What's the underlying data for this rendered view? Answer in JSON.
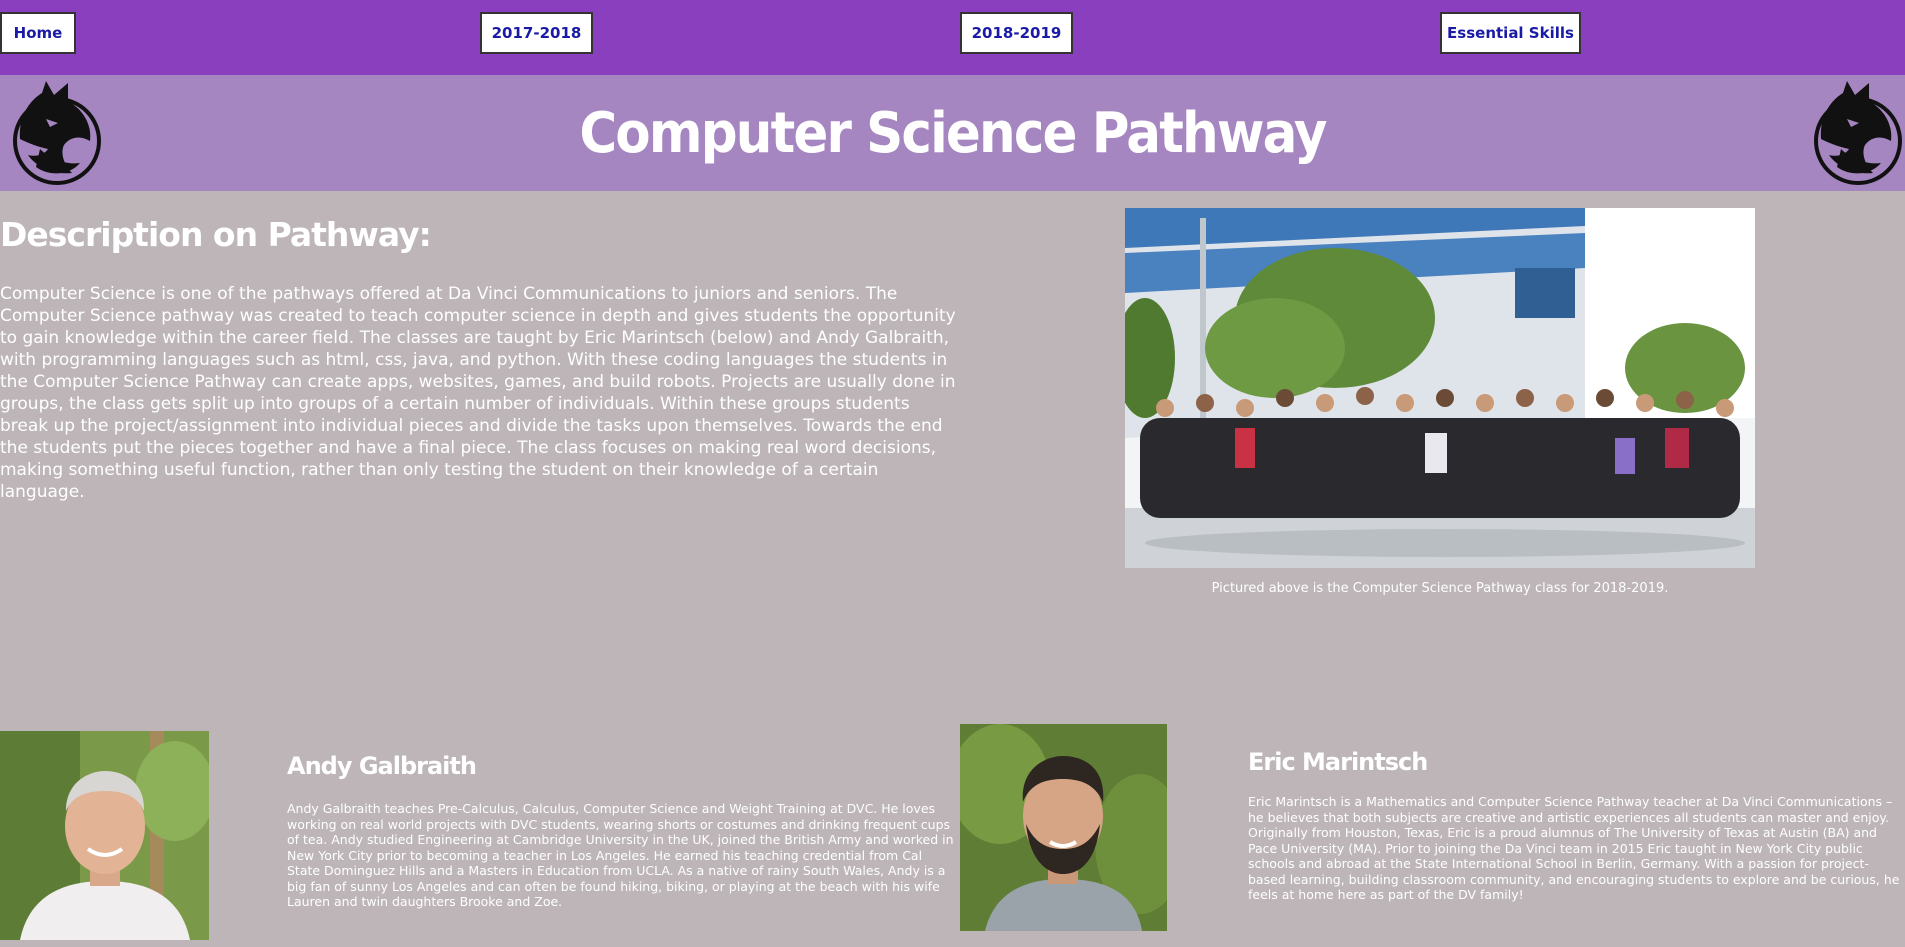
{
  "nav": {
    "home": "Home",
    "y2017": "2017-2018",
    "y2018": "2018-2019",
    "skills": "Essential Skills"
  },
  "banner": {
    "title": "Computer Science Pathway"
  },
  "description": {
    "heading": "Description on Pathway:",
    "body": "Computer Science is one of the pathways offered at Da Vinci Communications to juniors and seniors. The Computer Science pathway was created to teach computer science in depth and gives students the opportunity to gain knowledge within the career field. The classes are taught by Eric Marintsch (below) and Andy Galbraith, with programming languages such as html, css, java, and python. With these coding languages the students in the Computer Science Pathway can create apps, websites, games, and build robots. Projects are usually done in groups, the class gets split up into groups of a certain number of individuals. Within these groups students break up the project/assignment into individual pieces and divide the tasks upon themselves. Towards the end the students put the pieces together and have a final piece. The class focuses on making real word decisions, making something useful function, rather than only testing the student on their knowledge of a certain language."
  },
  "photo": {
    "caption": "Pictured above is the Computer Science Pathway class for 2018-2019."
  },
  "teachers": {
    "andy": {
      "name": "Andy Galbraith",
      "bio": "Andy Galbraith teaches Pre-Calculus, Calculus, Computer Science and Weight Training at DVC. He loves working on real world projects with DVC students, wearing shorts or costumes and drinking frequent cups of tea. Andy studied Engineering at Cambridge University in the UK, joined the British Army and worked in New York City prior to becoming a teacher in Los Angeles. He earned his teaching credential from Cal State Dominguez Hills and a Masters in Education from UCLA. As a native of rainy South Wales, Andy is a big fan of sunny Los Angeles and can often be found hiking, biking, or playing at the beach with his wife Lauren and twin daughters Brooke and Zoe."
    },
    "eric": {
      "name": "Eric Marintsch",
      "bio": "Eric Marintsch is a Mathematics and Computer Science Pathway teacher at Da Vinci Communications – he believes that both subjects are creative and artistic experiences all students can master and enjoy. Originally from Houston, Texas, Eric is a proud alumnus of The University of Texas at Austin (BA) and Pace University (MA). Prior to joining the Da Vinci team in 2015 Eric taught in New York City public schools and abroad at the State International School in Berlin, Germany. With a passion for project-based learning, building classroom community, and encouraging students to explore and be curious, he feels at home here as part of the DV family!"
    }
  },
  "colors": {
    "nav_bg": "#8a3fbf",
    "banner_bg": "#a686c0",
    "page_bg": "#bdb5b8",
    "nav_text": "#1a1aa6"
  },
  "icons": [
    "wolf-logo-icon"
  ]
}
